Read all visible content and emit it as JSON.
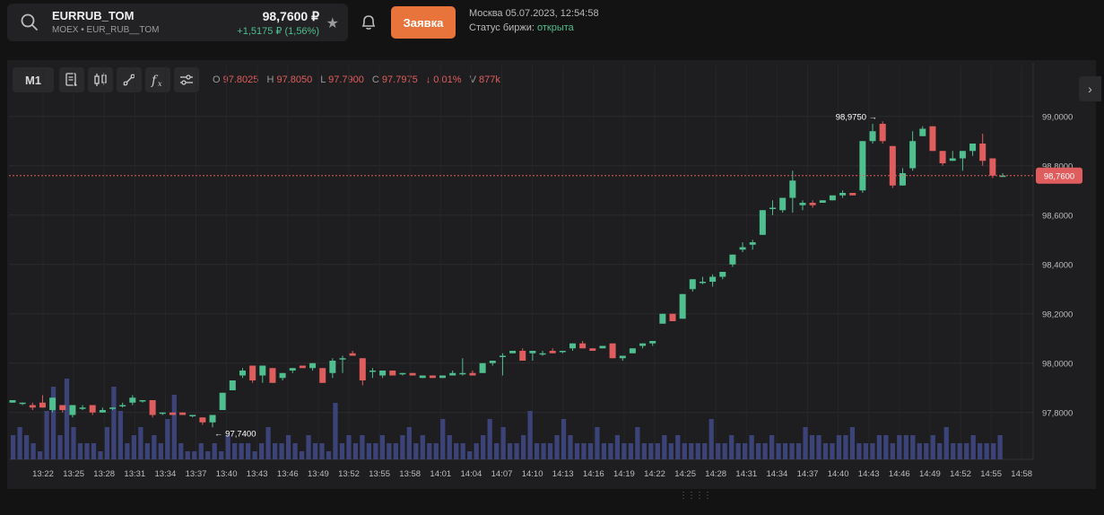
{
  "instrument": {
    "symbol": "EURRUB_TOM",
    "subtitle": "MOEX • EUR_RUB__TOM",
    "price": "98,7600 ₽",
    "change": "+1,5175 ₽ (1,56%)"
  },
  "order_button": "Заявка",
  "session": {
    "datetime": "Москва 05.07.2023, 12:54:58",
    "status_label": "Статус биржи:",
    "status_value": "открыта"
  },
  "toolbar": {
    "timeframe": "M1",
    "ohlc": {
      "o_label": "O",
      "o": "97.8025",
      "h_label": "H",
      "h": "97.8050",
      "l_label": "L",
      "l": "97.7900",
      "c_label": "C",
      "c": "97.7975",
      "chg": "↓ 0.01%",
      "v_label": "V",
      "v": "877k"
    }
  },
  "colors": {
    "up": "#4fbf8f",
    "down": "#e05d5d",
    "volume": "#3c4378",
    "accent": "#e8743b"
  },
  "chart_data": {
    "type": "candlestick",
    "y_ticks": [
      "99,0000",
      "98,8000",
      "98,6000",
      "98,4000",
      "98,2000",
      "98,0000",
      "97,8000"
    ],
    "x_ticks": [
      "13:22",
      "13:25",
      "13:28",
      "13:31",
      "13:34",
      "13:37",
      "13:40",
      "13:43",
      "13:46",
      "13:49",
      "13:52",
      "13:55",
      "13:58",
      "14:01",
      "14:04",
      "14:07",
      "14:10",
      "14:13",
      "14:16",
      "14:19",
      "14:22",
      "14:25",
      "14:28",
      "14:31",
      "14:34",
      "14:37",
      "14:40",
      "14:43",
      "14:46",
      "14:49",
      "14:52",
      "14:55",
      "14:58"
    ],
    "ylim": [
      97.69,
      99.05
    ],
    "current_price_label": "98,7600",
    "current_price": 98.76,
    "max_label": "98,9750",
    "min_label": "97,7400",
    "candles": [
      [
        97.84,
        97.85,
        97.84,
        97.85
      ],
      [
        97.84,
        97.84,
        97.83,
        97.84
      ],
      [
        97.83,
        97.84,
        97.81,
        97.82
      ],
      [
        97.84,
        97.87,
        97.82,
        97.82
      ],
      [
        97.81,
        97.86,
        97.8,
        97.86
      ],
      [
        97.83,
        97.83,
        97.8,
        97.81
      ],
      [
        97.79,
        97.83,
        97.78,
        97.83
      ],
      [
        97.82,
        97.83,
        97.81,
        97.82
      ],
      [
        97.83,
        97.82,
        97.79,
        97.8
      ],
      [
        97.8,
        97.82,
        97.8,
        97.81
      ],
      [
        97.82,
        97.82,
        97.81,
        97.82
      ],
      [
        97.83,
        97.84,
        97.82,
        97.83
      ],
      [
        97.84,
        97.87,
        97.83,
        97.86
      ],
      [
        97.85,
        97.85,
        97.84,
        97.85
      ],
      [
        97.85,
        97.85,
        97.78,
        97.79
      ],
      [
        97.8,
        97.8,
        97.79,
        97.8
      ],
      [
        97.8,
        97.8,
        97.79,
        97.79
      ],
      [
        97.8,
        97.8,
        97.79,
        97.79
      ],
      [
        97.79,
        97.79,
        97.78,
        97.79
      ],
      [
        97.78,
        97.78,
        97.75,
        97.76
      ],
      [
        97.76,
        97.79,
        97.74,
        97.79
      ],
      [
        97.81,
        97.88,
        97.81,
        97.88
      ],
      [
        97.89,
        97.93,
        97.89,
        97.93
      ],
      [
        97.95,
        97.98,
        97.94,
        97.97
      ],
      [
        97.99,
        97.99,
        97.92,
        97.93
      ],
      [
        97.95,
        97.99,
        97.92,
        97.99
      ],
      [
        97.98,
        97.98,
        97.92,
        97.92
      ],
      [
        97.94,
        97.96,
        97.93,
        97.96
      ],
      [
        97.97,
        97.98,
        97.96,
        97.98
      ],
      [
        97.99,
        97.99,
        97.98,
        97.98
      ],
      [
        97.98,
        98.0,
        97.97,
        98.0
      ],
      [
        97.98,
        97.98,
        97.92,
        97.92
      ],
      [
        97.96,
        98.02,
        97.94,
        98.01
      ],
      [
        98.02,
        98.03,
        97.96,
        98.02
      ],
      [
        98.04,
        98.05,
        98.03,
        98.03
      ],
      [
        98.02,
        98.02,
        97.91,
        97.93
      ],
      [
        97.97,
        97.98,
        97.94,
        97.97
      ],
      [
        97.95,
        97.97,
        97.94,
        97.97
      ],
      [
        97.97,
        97.97,
        97.95,
        97.95
      ],
      [
        97.96,
        97.96,
        97.95,
        97.96
      ],
      [
        97.96,
        97.96,
        97.95,
        97.95
      ],
      [
        97.94,
        97.95,
        97.94,
        97.95
      ],
      [
        97.95,
        97.95,
        97.94,
        97.94
      ],
      [
        97.94,
        97.95,
        97.94,
        97.95
      ],
      [
        97.95,
        97.97,
        97.95,
        97.96
      ],
      [
        97.96,
        98.02,
        97.95,
        97.96
      ],
      [
        97.96,
        97.97,
        97.95,
        97.95
      ],
      [
        97.96,
        98.0,
        97.96,
        98.0
      ],
      [
        98.0,
        98.01,
        97.99,
        98.01
      ],
      [
        98.03,
        98.04,
        97.95,
        98.03
      ],
      [
        98.04,
        98.05,
        98.04,
        98.05
      ],
      [
        98.05,
        98.06,
        98.01,
        98.01
      ],
      [
        98.04,
        98.05,
        98.01,
        98.05
      ],
      [
        98.04,
        98.05,
        98.03,
        98.04
      ],
      [
        98.05,
        98.06,
        98.04,
        98.04
      ],
      [
        98.05,
        98.05,
        98.04,
        98.05
      ],
      [
        98.06,
        98.08,
        98.05,
        98.08
      ],
      [
        98.08,
        98.09,
        98.06,
        98.06
      ],
      [
        98.06,
        98.06,
        98.05,
        98.05
      ],
      [
        98.06,
        98.07,
        98.06,
        98.07
      ],
      [
        98.08,
        98.08,
        98.02,
        98.02
      ],
      [
        98.02,
        98.03,
        98.01,
        98.03
      ],
      [
        98.04,
        98.06,
        98.04,
        98.06
      ],
      [
        98.07,
        98.08,
        98.06,
        98.08
      ],
      [
        98.08,
        98.09,
        98.07,
        98.09
      ],
      [
        98.16,
        98.2,
        98.16,
        98.2
      ],
      [
        98.2,
        98.2,
        98.17,
        98.17
      ],
      [
        98.18,
        98.28,
        98.18,
        98.28
      ],
      [
        98.3,
        98.34,
        98.29,
        98.34
      ],
      [
        98.33,
        98.35,
        98.32,
        98.33
      ],
      [
        98.33,
        98.36,
        98.31,
        98.35
      ],
      [
        98.35,
        98.37,
        98.34,
        98.37
      ],
      [
        98.4,
        98.44,
        98.39,
        98.44
      ],
      [
        98.46,
        98.49,
        98.45,
        98.47
      ],
      [
        98.48,
        98.5,
        98.46,
        98.49
      ],
      [
        98.52,
        98.62,
        98.52,
        98.62
      ],
      [
        98.63,
        98.66,
        98.6,
        98.63
      ],
      [
        98.62,
        98.67,
        98.61,
        98.67
      ],
      [
        98.67,
        98.78,
        98.61,
        98.74
      ],
      [
        98.64,
        98.66,
        98.62,
        98.65
      ],
      [
        98.65,
        98.66,
        98.63,
        98.64
      ],
      [
        98.65,
        98.66,
        98.65,
        98.66
      ],
      [
        98.66,
        98.67,
        98.66,
        98.68
      ],
      [
        98.68,
        98.7,
        98.67,
        98.69
      ],
      [
        98.69,
        98.69,
        98.68,
        98.68
      ],
      [
        98.7,
        98.9,
        98.69,
        98.9
      ],
      [
        98.9,
        98.97,
        98.89,
        98.94
      ],
      [
        98.97,
        98.98,
        98.89,
        98.9
      ],
      [
        98.88,
        98.88,
        98.71,
        98.72
      ],
      [
        98.72,
        98.79,
        98.72,
        98.77
      ],
      [
        98.79,
        98.94,
        98.78,
        98.9
      ],
      [
        98.92,
        98.96,
        98.92,
        98.95
      ],
      [
        98.96,
        98.96,
        98.86,
        98.86
      ],
      [
        98.86,
        98.86,
        98.8,
        98.81
      ],
      [
        98.82,
        98.86,
        98.82,
        98.83
      ],
      [
        98.83,
        98.86,
        98.78,
        98.86
      ],
      [
        98.86,
        98.89,
        98.84,
        98.89
      ],
      [
        98.89,
        98.93,
        98.8,
        98.82
      ],
      [
        98.83,
        98.83,
        98.75,
        98.76
      ],
      [
        98.76,
        98.77,
        98.76,
        98.76
      ]
    ],
    "volumes": [
      0.3,
      0.4,
      0.3,
      0.2,
      0.1,
      0.6,
      0.9,
      0.3,
      1.0,
      0.4,
      0.2,
      0.2,
      0.2,
      0.1,
      0.4,
      0.9,
      0.6,
      0.2,
      0.3,
      0.4,
      0.2,
      0.3,
      0.2,
      0.5,
      0.8,
      0.2,
      0.1,
      0.1,
      0.2,
      0.1,
      0.2,
      0.1,
      0.3,
      0.2,
      0.2,
      0.2,
      0.1,
      0.2,
      0.4,
      0.2,
      0.2,
      0.3,
      0.2,
      0.1,
      0.3,
      0.2,
      0.2,
      0.1,
      0.7,
      0.2,
      0.3,
      0.2,
      0.3,
      0.2,
      0.2,
      0.3,
      0.2,
      0.2,
      0.3,
      0.4,
      0.2,
      0.3,
      0.2,
      0.2,
      0.5,
      0.3,
      0.2,
      0.2,
      0.1,
      0.2,
      0.3,
      0.5,
      0.2,
      0.4,
      0.2,
      0.2,
      0.3,
      0.6,
      0.2,
      0.2,
      0.2,
      0.3,
      0.5,
      0.3,
      0.2,
      0.2,
      0.2,
      0.4,
      0.2,
      0.2,
      0.3,
      0.2,
      0.2,
      0.4,
      0.2,
      0.2,
      0.2,
      0.3,
      0.2,
      0.3,
      0.2,
      0.2,
      0.2,
      0.2,
      0.5,
      0.2,
      0.2,
      0.3,
      0.2,
      0.2,
      0.3,
      0.2,
      0.2,
      0.3,
      0.2,
      0.2,
      0.2,
      0.2,
      0.4,
      0.3,
      0.3,
      0.2,
      0.2,
      0.3,
      0.3,
      0.4,
      0.2,
      0.2,
      0.2,
      0.3,
      0.3,
      0.2,
      0.3,
      0.3,
      0.3,
      0.2,
      0.2,
      0.3,
      0.2,
      0.4,
      0.2,
      0.2,
      0.2,
      0.3,
      0.2,
      0.2,
      0.2,
      0.3
    ]
  }
}
